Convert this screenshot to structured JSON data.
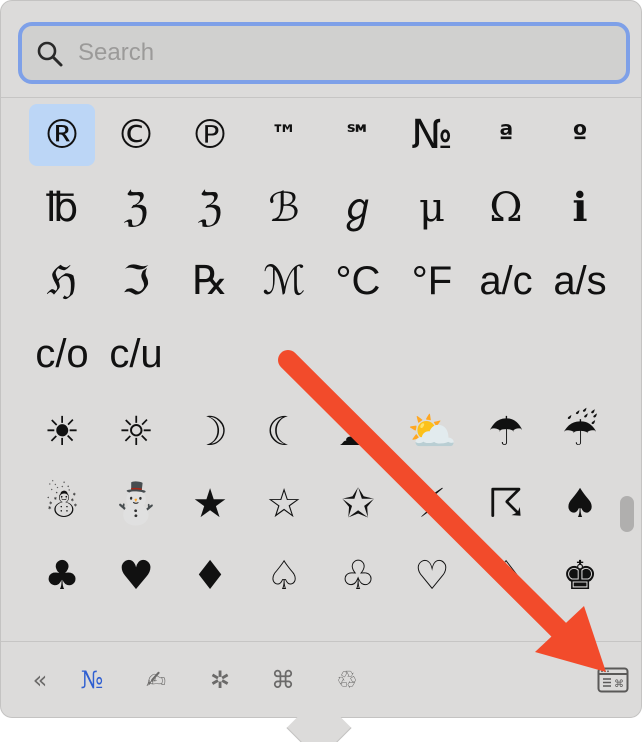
{
  "search": {
    "placeholder": "Search"
  },
  "symbols": [
    {
      "glyph": "®",
      "selected": true
    },
    {
      "glyph": "©"
    },
    {
      "glyph": "℗"
    },
    {
      "glyph": "™"
    },
    {
      "glyph": "℠"
    },
    {
      "glyph": "№"
    },
    {
      "glyph": "ª"
    },
    {
      "glyph": "º"
    },
    {
      "glyph": "℔"
    },
    {
      "glyph": "ℨ"
    },
    {
      "glyph": "ℨ"
    },
    {
      "glyph": "ℬ"
    },
    {
      "glyph": "ℊ"
    },
    {
      "glyph": "μ"
    },
    {
      "glyph": "Ω"
    },
    {
      "glyph": "ℹ"
    },
    {
      "glyph": "ℌ"
    },
    {
      "glyph": "ℑ"
    },
    {
      "glyph": "℞"
    },
    {
      "glyph": "ℳ"
    },
    {
      "glyph": "°C"
    },
    {
      "glyph": "°F"
    },
    {
      "glyph": "a/c"
    },
    {
      "glyph": "a/s"
    },
    {
      "glyph": "c/o"
    },
    {
      "glyph": "c/u"
    }
  ],
  "pictographs": [
    "☀",
    "☼",
    "☽",
    "☾",
    "☁",
    "⛅",
    "☂",
    "☔",
    "☃",
    "⛄",
    "★",
    "☆",
    "✩",
    "⚡",
    "☈",
    "♠",
    "♣",
    "♥",
    "♦",
    "♤",
    "♧",
    "♡",
    "♢",
    "♚"
  ],
  "toolbar": {
    "collapse_label": "«",
    "numberlike_label": "№",
    "signature_label": "✍",
    "asterisk_label": "✲",
    "command_label": "⌘",
    "recycle_label": "♲",
    "character_viewer_icon": "keyboard-window-icon"
  },
  "colors": {
    "accent": "#2f5fd1",
    "selection": "#bcd6f6",
    "focus_ring": "#7ea0e8",
    "annotation_arrow": "#f24b2b"
  }
}
